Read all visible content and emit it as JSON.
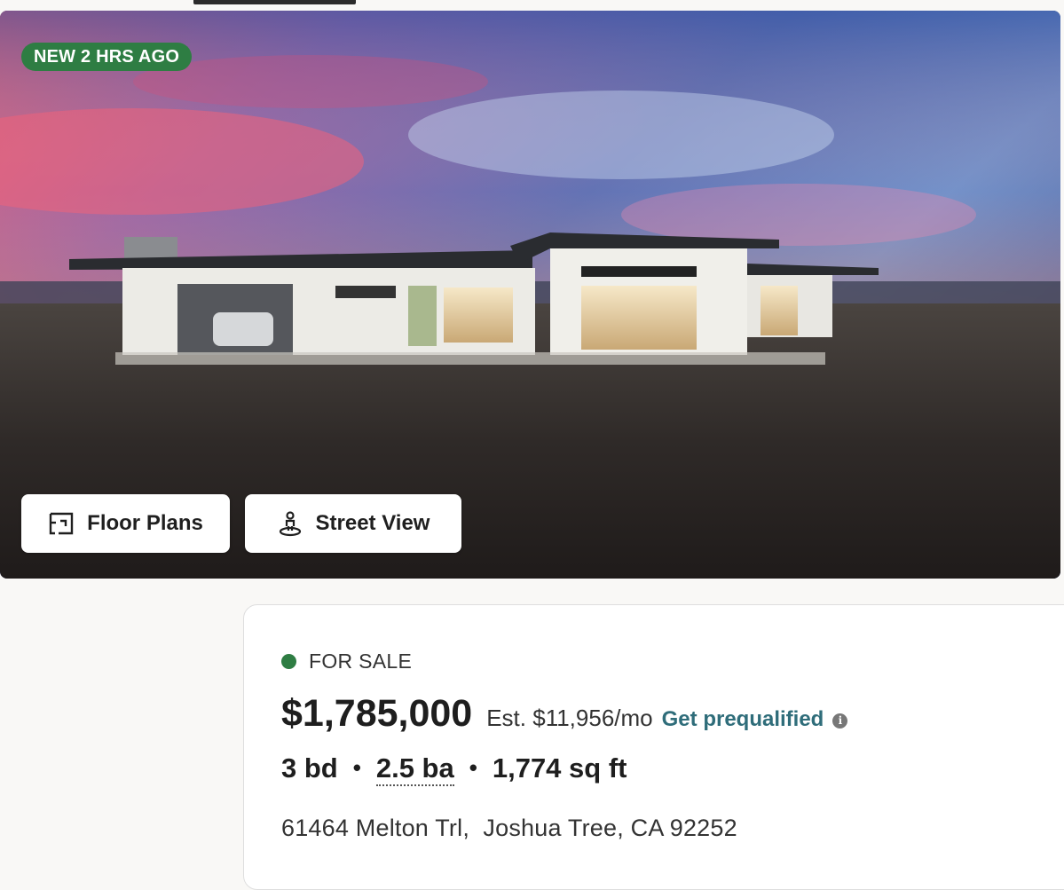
{
  "listing": {
    "badge": "NEW 2 HRS AGO",
    "photo": {
      "alt_icon": "house-photo",
      "buttons": {
        "floor_plans": "Floor Plans",
        "street_view": "Street View"
      }
    },
    "status": "FOR SALE",
    "price": "$1,785,000",
    "est_payment": "Est. $11,956/mo",
    "prequal_link": "Get prequalified",
    "info_icon_glyph": "i",
    "beds": "3 bd",
    "separator": "•",
    "baths": "2.5 ba",
    "sqft": "1,774 sq ft",
    "address": "61464 Melton Trl,  Joshua Tree, CA 92252"
  },
  "colors": {
    "badge_green": "#2e7d43",
    "status_green": "#2e7d43",
    "link_teal": "#2f6d7a"
  },
  "icons": {
    "floor_plans": "floor-plan-icon",
    "street_view": "street-view-person-icon",
    "info": "info-icon"
  }
}
